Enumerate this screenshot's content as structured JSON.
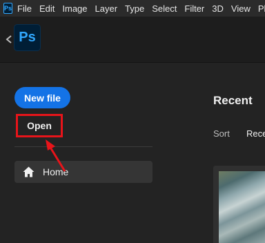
{
  "menubar": {
    "app_icon": "Ps",
    "items": [
      "File",
      "Edit",
      "Image",
      "Layer",
      "Type",
      "Select",
      "Filter",
      "3D",
      "View",
      "Plug"
    ]
  },
  "appbar": {
    "logo": "Ps",
    "back_icon": "chevron-left-icon"
  },
  "sidebar": {
    "new_file_label": "New file",
    "open_label": "Open",
    "home_label": "Home",
    "home_icon": "home-icon"
  },
  "content": {
    "recent_title": "Recent",
    "sort_label": "Sort",
    "sort_value": "Rece"
  },
  "colors": {
    "accent": "#1473e6",
    "highlight": "#e8141a",
    "ps_blue": "#31a8ff"
  }
}
